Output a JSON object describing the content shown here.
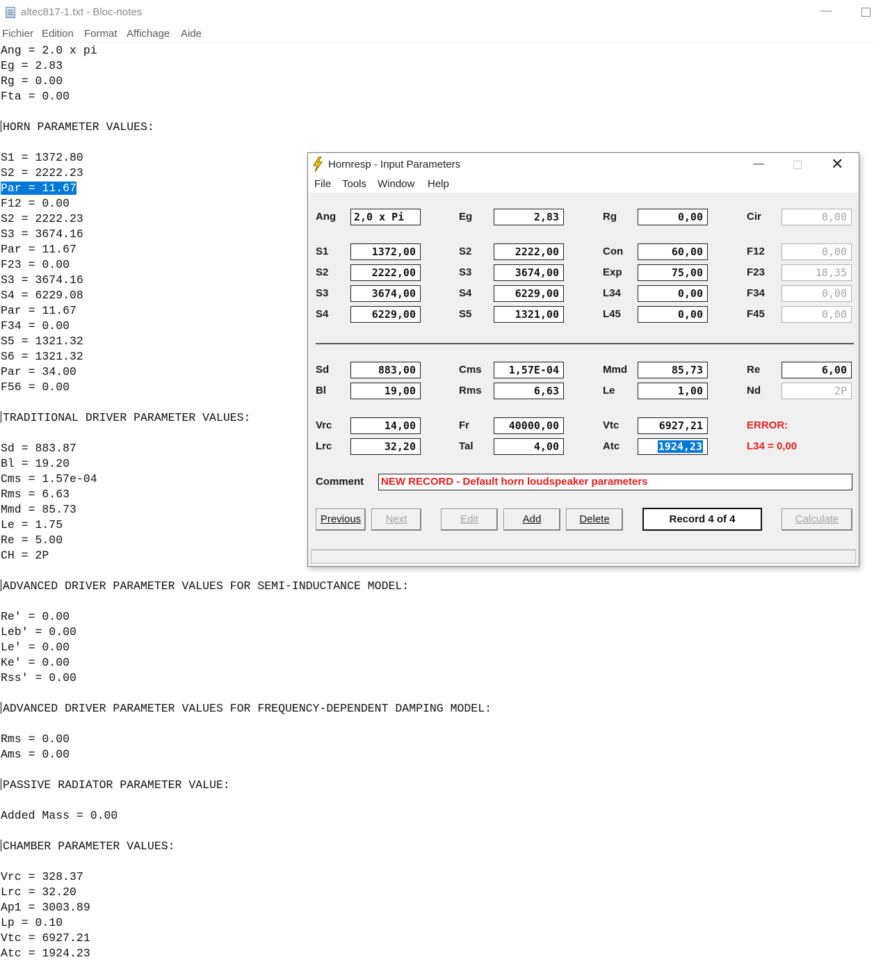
{
  "notepad": {
    "title": "altec817-1.txt - Bloc-notes",
    "menu": [
      "Fichier",
      "Edition",
      "Format",
      "Affichage",
      "Aide"
    ],
    "lines": [
      "Ang = 2.0 x pi",
      "Eg = 2.83",
      "Rg = 0.00",
      "Fta = 0.00",
      "",
      "|HORN PARAMETER VALUES:",
      "",
      "S1 = 1372.80",
      "S2 = 2222.23",
      "Par = 11.67",
      "F12 = 0.00",
      "S2 = 2222.23",
      "S3 = 3674.16",
      "Par = 11.67",
      "F23 = 0.00",
      "S3 = 3674.16",
      "S4 = 6229.08",
      "Par = 11.67",
      "F34 = 0.00",
      "S5 = 1321.32",
      "S6 = 1321.32",
      "Par = 34.00",
      "F56 = 0.00",
      "",
      "|TRADITIONAL DRIVER PARAMETER VALUES:",
      "",
      "Sd = 883.87",
      "Bl = 19.20",
      "Cms = 1.57e-04",
      "Rms = 6.63",
      "Mmd = 85.73",
      "Le = 1.75",
      "Re = 5.00",
      "CH = 2P",
      "",
      "|ADVANCED DRIVER PARAMETER VALUES FOR SEMI-INDUCTANCE MODEL:",
      "",
      "Re' = 0.00",
      "Leb' = 0.00",
      "Le' = 0.00",
      "Ke' = 0.00",
      "Rss' = 0.00",
      "",
      "|ADVANCED DRIVER PARAMETER VALUES FOR FREQUENCY-DEPENDENT DAMPING MODEL:",
      "",
      "Rms = 0.00",
      "Ams = 0.00",
      "",
      "|PASSIVE RADIATOR PARAMETER VALUE:",
      "",
      "Added Mass = 0.00",
      "",
      "|CHAMBER PARAMETER VALUES:",
      "",
      "Vrc = 328.37",
      "Lrc = 32.20",
      "Ap1 = 3003.89",
      "Lp = 0.10",
      "Vtc = 6927.21",
      "Atc = 1924.23"
    ],
    "selected_line_index": 9
  },
  "dialog": {
    "title": "Hornresp - Input Parameters",
    "menu": [
      "File",
      "Tools",
      "Window",
      "Help"
    ],
    "params": [
      {
        "label": "Ang",
        "value": "2,0 x Pi",
        "state": "normal"
      },
      {
        "label": "Eg",
        "value": "2,83",
        "state": "normal"
      },
      {
        "label": "Rg",
        "value": "0,00",
        "state": "normal"
      },
      {
        "label": "Cir",
        "value": "0,00",
        "state": "disabled"
      },
      {
        "label": "S1",
        "value": "1372,00",
        "state": "normal"
      },
      {
        "label": "S2",
        "value": "2222,00",
        "state": "normal"
      },
      {
        "label": "Con",
        "value": "60,00",
        "state": "normal"
      },
      {
        "label": "F12",
        "value": "0,00",
        "state": "disabled"
      },
      {
        "label": "S2",
        "value": "2222,00",
        "state": "normal"
      },
      {
        "label": "S3",
        "value": "3674,00",
        "state": "normal"
      },
      {
        "label": "Exp",
        "value": "75,00",
        "state": "normal"
      },
      {
        "label": "F23",
        "value": "18,35",
        "state": "disabled"
      },
      {
        "label": "S3",
        "value": "3674,00",
        "state": "normal"
      },
      {
        "label": "S4",
        "value": "6229,00",
        "state": "normal"
      },
      {
        "label": "L34",
        "value": "0,00",
        "state": "normal"
      },
      {
        "label": "F34",
        "value": "0,00",
        "state": "disabled"
      },
      {
        "label": "S4",
        "value": "6229,00",
        "state": "normal"
      },
      {
        "label": "S5",
        "value": "1321,00",
        "state": "normal"
      },
      {
        "label": "L45",
        "value": "0,00",
        "state": "normal"
      },
      {
        "label": "F45",
        "value": "0,00",
        "state": "disabled"
      },
      {
        "label": "Sd",
        "value": "883,00",
        "state": "normal"
      },
      {
        "label": "Cms",
        "value": "1,57E-04",
        "state": "normal"
      },
      {
        "label": "Mmd",
        "value": "85,73",
        "state": "normal"
      },
      {
        "label": "Re",
        "value": "6,00",
        "state": "normal"
      },
      {
        "label": "Bl",
        "value": "19,00",
        "state": "normal"
      },
      {
        "label": "Rms",
        "value": "6,63",
        "state": "normal"
      },
      {
        "label": "Le",
        "value": "1,00",
        "state": "normal"
      },
      {
        "label": "Nd",
        "value": "2P",
        "state": "disabled"
      },
      {
        "label": "Vrc",
        "value": "14,00",
        "state": "normal"
      },
      {
        "label": "Fr",
        "value": "40000,00",
        "state": "normal"
      },
      {
        "label": "Vtc",
        "value": "6927,21",
        "state": "normal"
      },
      {
        "label": "Lrc",
        "value": "32,20",
        "state": "normal"
      },
      {
        "label": "Tal",
        "value": "4,00",
        "state": "normal"
      },
      {
        "label": "Atc",
        "value": "1924,23",
        "state": "selected"
      }
    ],
    "error_title": "ERROR:",
    "error_detail": "L34 = 0,00",
    "comment_label": "Comment",
    "comment_value": "NEW RECORD - Default horn loudspeaker parameters",
    "buttons": {
      "previous": "Previous",
      "next": "Next",
      "edit": "Edit",
      "add": "Add",
      "delete": "Delete",
      "record": "Record 4 of 4",
      "calculate": "Calculate"
    },
    "colors": {
      "error": "#e21e1e",
      "selection": "#0078d7"
    }
  }
}
